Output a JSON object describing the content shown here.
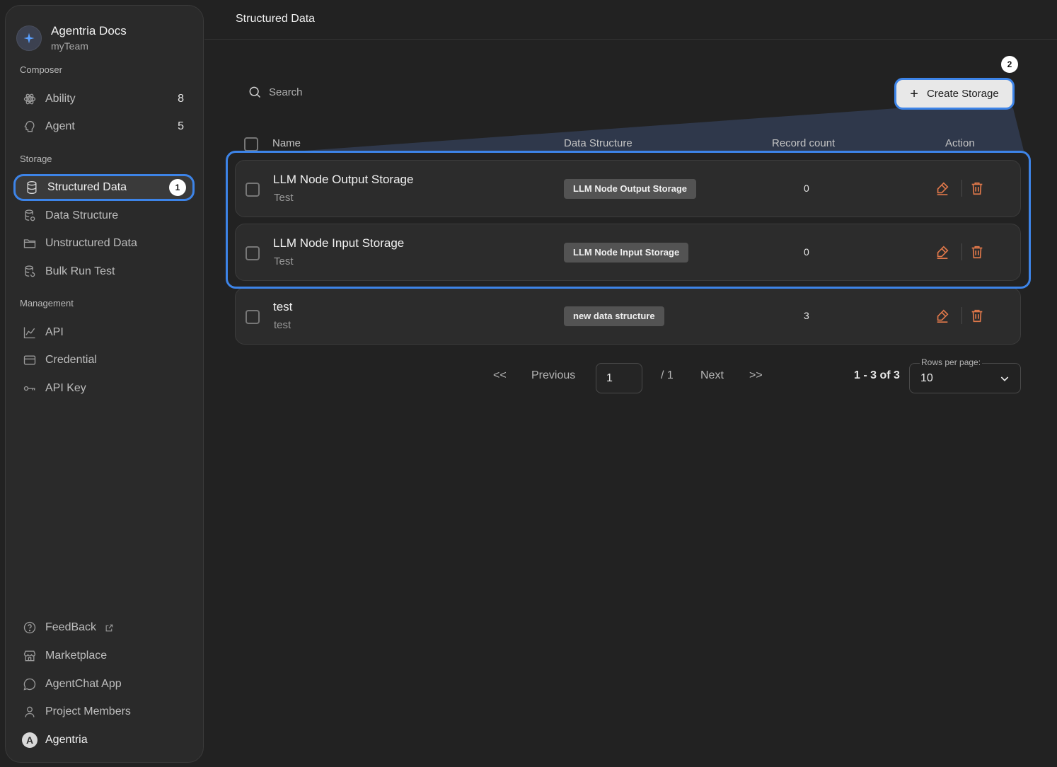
{
  "brand": {
    "title": "Agentria Docs",
    "team": "myTeam"
  },
  "sidebar": {
    "sections": {
      "composer": "Composer",
      "storage": "Storage",
      "management": "Management"
    },
    "composer_items": [
      {
        "label": "Ability",
        "count": "8",
        "icon": "ability-icon"
      },
      {
        "label": "Agent",
        "count": "5",
        "icon": "agent-icon"
      }
    ],
    "storage_items": [
      {
        "label": "Structured Data",
        "icon": "database-icon",
        "active": true,
        "badge": "1"
      },
      {
        "label": "Data Structure",
        "icon": "data-structure-icon"
      },
      {
        "label": "Unstructured Data",
        "icon": "folder-icon"
      },
      {
        "label": "Bulk Run Test",
        "icon": "bulk-run-icon"
      }
    ],
    "management_items": [
      {
        "label": "API",
        "icon": "chart-icon"
      },
      {
        "label": "Credential",
        "icon": "card-icon"
      },
      {
        "label": "API Key",
        "icon": "key-icon"
      }
    ],
    "footer_items": [
      {
        "label": "FeedBack",
        "icon": "help-icon",
        "external": true
      },
      {
        "label": "Marketplace",
        "icon": "store-icon"
      },
      {
        "label": "AgentChat App",
        "icon": "chat-icon"
      },
      {
        "label": "Project Members",
        "icon": "user-icon"
      },
      {
        "label": "Agentria",
        "avatar_letter": "A"
      }
    ]
  },
  "header": {
    "title": "Structured Data"
  },
  "toolbar": {
    "search_placeholder": "Search",
    "create_label": "Create Storage",
    "create_badge": "2"
  },
  "table": {
    "columns": [
      "Name",
      "Data Structure",
      "Record count",
      "Action"
    ],
    "rows": [
      {
        "name": "LLM Node Output Storage",
        "description": "Test",
        "data_structure": "LLM Node Output Storage",
        "record_count": "0"
      },
      {
        "name": "LLM Node Input Storage",
        "description": "Test",
        "data_structure": "LLM Node Input Storage",
        "record_count": "0"
      },
      {
        "name": "test",
        "description": "test",
        "data_structure": "new data structure",
        "record_count": "3"
      }
    ]
  },
  "pagination": {
    "first": "<<",
    "previous": "Previous",
    "page": "1",
    "total_pages": "/ 1",
    "next": "Next",
    "last": ">>",
    "range": "1 - 3 of 3",
    "rows_per_page_label": "Rows per page:",
    "rows_per_page": "10"
  },
  "colors": {
    "accent": "#3d84e8",
    "action_icon": "#e0784a",
    "background": "#222222",
    "sidebar": "#2a2a2a"
  }
}
